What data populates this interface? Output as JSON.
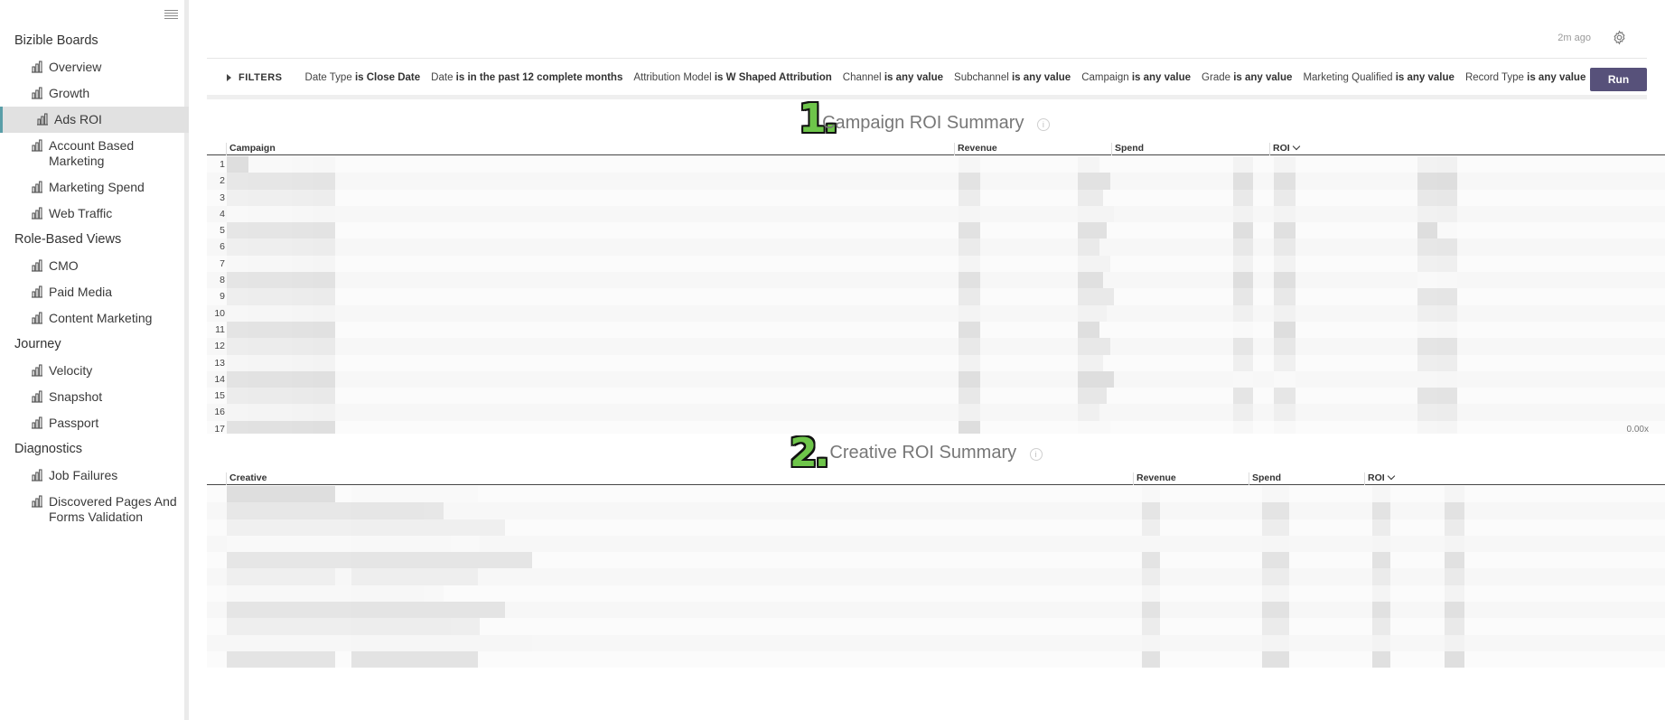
{
  "sidebar": {
    "menu_icon": "hamburger-icon",
    "groups": [
      {
        "title": "Bizible Boards",
        "items": [
          {
            "label": "Overview",
            "icon": "bar-chart-icon",
            "active": false
          },
          {
            "label": "Growth",
            "icon": "bar-chart-icon",
            "active": false
          },
          {
            "label": "Ads ROI",
            "icon": "bar-chart-icon",
            "active": true
          },
          {
            "label": "Account Based Marketing",
            "icon": "bar-chart-icon",
            "active": false
          },
          {
            "label": "Marketing Spend",
            "icon": "bar-chart-icon",
            "active": false
          },
          {
            "label": "Web Traffic",
            "icon": "bar-chart-icon",
            "active": false
          }
        ]
      },
      {
        "title": "Role-Based Views",
        "items": [
          {
            "label": "CMO",
            "icon": "bar-chart-icon",
            "active": false
          },
          {
            "label": "Paid Media",
            "icon": "bar-chart-icon",
            "active": false
          },
          {
            "label": "Content Marketing",
            "icon": "bar-chart-icon",
            "active": false
          }
        ]
      },
      {
        "title": "Journey",
        "items": [
          {
            "label": "Velocity",
            "icon": "bar-chart-icon",
            "active": false
          },
          {
            "label": "Snapshot",
            "icon": "bar-chart-icon",
            "active": false
          },
          {
            "label": "Passport",
            "icon": "bar-chart-icon",
            "active": false
          }
        ]
      },
      {
        "title": "Diagnostics",
        "items": [
          {
            "label": "Job Failures",
            "icon": "bar-chart-icon",
            "active": false
          },
          {
            "label": "Discovered Pages And Forms Validation",
            "icon": "bar-chart-icon",
            "active": false
          }
        ]
      }
    ]
  },
  "header": {
    "updated": "2m ago",
    "settings_icon": "gear-icon"
  },
  "filters": {
    "toggle_label": "FILTERS",
    "items": [
      {
        "name": "Date Type",
        "op": "is Close Date"
      },
      {
        "name": "Date",
        "op": "is in the past 12 complete months"
      },
      {
        "name": "Attribution Model",
        "op": "is W Shaped Attribution"
      },
      {
        "name": "Channel",
        "op": "is any value"
      },
      {
        "name": "Subchannel",
        "op": "is any value"
      },
      {
        "name": "Campaign",
        "op": "is any value"
      },
      {
        "name": "Grade",
        "op": "is any value"
      },
      {
        "name": "Marketing Qualified",
        "op": "is any value"
      },
      {
        "name": "Record Type",
        "op": "is any value"
      }
    ],
    "run_label": "Run"
  },
  "tiles": {
    "campaign": {
      "badge": "1.",
      "title": "Campaign ROI Summary",
      "info_icon": "info-icon",
      "columns": [
        "Campaign",
        "Revenue",
        "Spend",
        "ROI"
      ],
      "row_numbers": [
        "1",
        "2",
        "3",
        "4",
        "5",
        "6",
        "7",
        "8",
        "9",
        "10",
        "11",
        "12",
        "13",
        "14",
        "15",
        "16",
        "17"
      ],
      "footer_value": "0.00x"
    },
    "creative": {
      "badge": "2.",
      "title": "Creative ROI Summary",
      "info_icon": "info-icon",
      "columns": [
        "Creative",
        "Revenue",
        "Spend",
        "ROI"
      ]
    }
  },
  "colors": {
    "run_button": "#57517a",
    "active_accent": "#5a9ea8",
    "badge_green": "#6ec54a"
  }
}
